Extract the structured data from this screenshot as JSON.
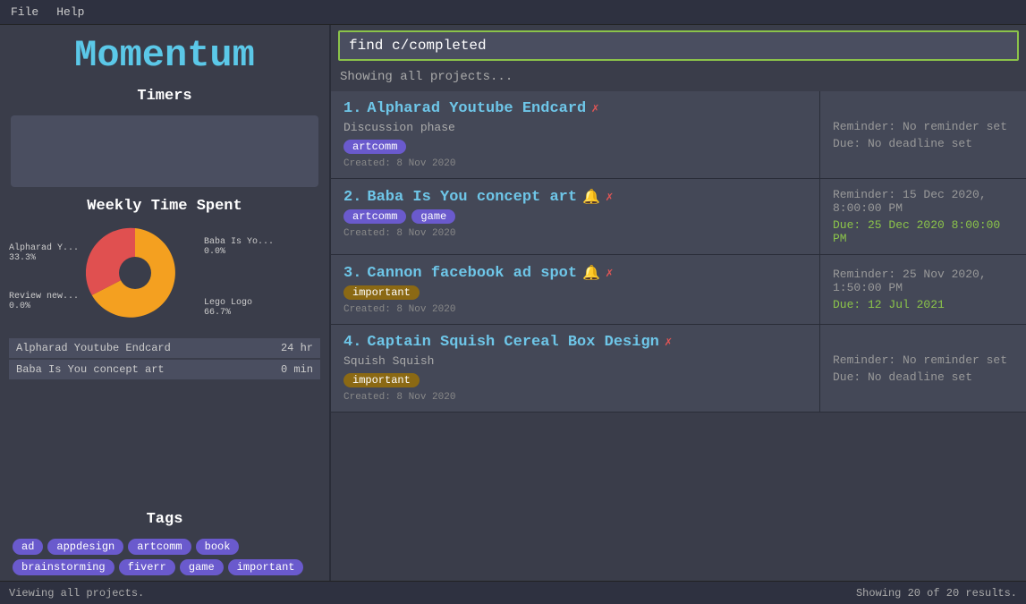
{
  "menubar": {
    "items": [
      "File",
      "Help"
    ]
  },
  "sidebar": {
    "title": "Momentum",
    "timers_label": "Timers",
    "weekly_label": "Weekly Time Spent",
    "tags_label": "Tags",
    "pie": {
      "segments": [
        {
          "label": "Alpharad Y...",
          "pct": "33.3%",
          "color": "#e05050",
          "degrees": 120
        },
        {
          "label": "Baba Is Yo...",
          "pct": "0.0%",
          "color": "#f4b942",
          "degrees": 2
        },
        {
          "label": "Lego Logo",
          "pct": "66.7%",
          "color": "#f4a020",
          "degrees": 240
        },
        {
          "label": "Review new...",
          "pct": "0.0%",
          "color": "#cc3333",
          "degrees": 2
        }
      ]
    },
    "time_rows": [
      {
        "project": "Alpharad Youtube Endcard",
        "time": "24 hr"
      },
      {
        "project": "Baba Is You concept art",
        "time": "0 min"
      }
    ],
    "tags": [
      "ad",
      "appdesign",
      "artcomm",
      "book",
      "brainstorming",
      "fiverr",
      "game",
      "important"
    ]
  },
  "content": {
    "search_value": "find c/completed",
    "showing_label": "Showing all projects...",
    "projects": [
      {
        "number": "1",
        "title": "Alpharad Youtube Endcard",
        "has_bell": false,
        "has_x": true,
        "subtitle": "Discussion phase",
        "tags": [
          {
            "label": "artcomm",
            "type": "purple"
          }
        ],
        "created": "Created: 8 Nov 2020",
        "reminder": "Reminder: No reminder set",
        "due": "Due: No deadline set",
        "due_color": "neutral"
      },
      {
        "number": "2",
        "title": "Baba Is You concept art",
        "has_bell": true,
        "has_x": true,
        "subtitle": "",
        "tags": [
          {
            "label": "artcomm",
            "type": "purple"
          },
          {
            "label": "game",
            "type": "purple"
          }
        ],
        "created": "Created: 8 Nov 2020",
        "reminder": "Reminder: 15 Dec 2020, 8:00:00 PM",
        "due": "Due: 25 Dec 2020 8:00:00 PM",
        "due_color": "green"
      },
      {
        "number": "3",
        "title": "Cannon facebook ad spot",
        "has_bell": true,
        "has_x": true,
        "subtitle": "",
        "tags": [
          {
            "label": "important",
            "type": "important"
          }
        ],
        "created": "Created: 8 Nov 2020",
        "reminder": "Reminder: 25 Nov 2020, 1:50:00 PM",
        "due": "Due: 12 Jul 2021",
        "due_color": "green"
      },
      {
        "number": "4",
        "title": "Captain Squish Cereal Box Design",
        "has_bell": false,
        "has_x": true,
        "subtitle": "Squish Squish",
        "tags": [
          {
            "label": "important",
            "type": "important"
          }
        ],
        "created": "Created: 8 Nov 2020",
        "reminder": "Reminder: No reminder set",
        "due": "Due: No deadline set",
        "due_color": "neutral"
      }
    ]
  },
  "statusbar": {
    "left": "Viewing all projects.",
    "right": "Showing 20 of 20 results."
  }
}
